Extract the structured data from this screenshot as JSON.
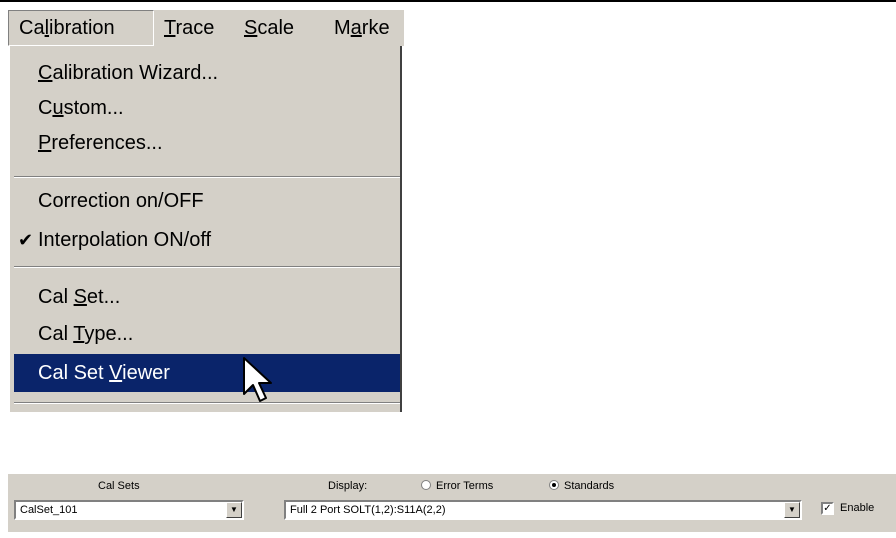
{
  "menubar": {
    "items": [
      {
        "pre": "Ca",
        "acc": "l",
        "post": "ibration"
      },
      {
        "pre": "",
        "acc": "T",
        "post": "race"
      },
      {
        "pre": "",
        "acc": "S",
        "post": "cale"
      },
      {
        "pre": "M",
        "acc": "a",
        "post": "rke"
      }
    ]
  },
  "dropdown": {
    "items": [
      {
        "pre": "",
        "acc": "C",
        "post": "alibration Wizard..."
      },
      {
        "pre": "C",
        "acc": "u",
        "post": "stom..."
      },
      {
        "pre": "",
        "acc": "P",
        "post": "references..."
      },
      {
        "text": "Correction on/OFF"
      },
      {
        "text": "Interpolation ON/off",
        "check": "✔"
      },
      {
        "pre": "Cal ",
        "acc": "S",
        "post": "et..."
      },
      {
        "pre": "Cal ",
        "acc": "T",
        "post": "ype..."
      },
      {
        "pre": "Cal Set ",
        "acc": "V",
        "post": "iewer"
      }
    ]
  },
  "toolbar": {
    "cal_sets_label": "Cal Sets",
    "cal_set_value": "CalSet_101",
    "display_label": "Display:",
    "error_terms_label": "Error Terms",
    "standards_label": "Standards",
    "standard_value": "Full 2 Port SOLT(1,2):S11A(2,2)",
    "enable_label": "Enable",
    "enable_checked": "✓",
    "dropdown_arrow": "▼"
  },
  "colors": {
    "menu_bg": "#d4d0c8",
    "highlight": "#0a246a",
    "highlight_text": "#ffffff"
  },
  "icons": {
    "cursor": "arrow-pointer-icon",
    "check": "checkmark-icon",
    "combo": "chevron-down-icon"
  }
}
